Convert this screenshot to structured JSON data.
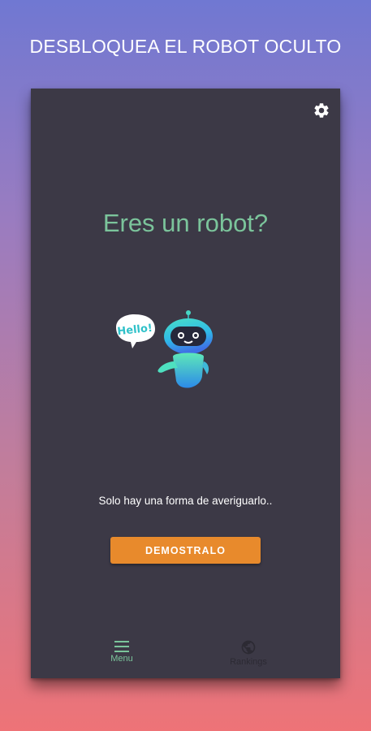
{
  "promo": {
    "headline": "DESBLOQUEA EL ROBOT OCULTO"
  },
  "screen": {
    "question": "Eres un robot?",
    "bubble_text": "Hello!",
    "tagline": "Solo hay una forma de averiguarlo..",
    "cta_label": "DEMOSTRALO",
    "settings_icon": "gear-icon"
  },
  "navbar": {
    "items": [
      {
        "label": "Menu",
        "icon": "menu-icon",
        "active": true
      },
      {
        "label": "Rankings",
        "icon": "globe-icon",
        "active": false
      }
    ]
  },
  "colors": {
    "background_top": "#7078d2",
    "background_bottom": "#ee7377",
    "card": "#3c3946",
    "accent_green": "#7bc49b",
    "button_orange": "#e88a2c",
    "inactive_nav": "#2c2a33"
  }
}
